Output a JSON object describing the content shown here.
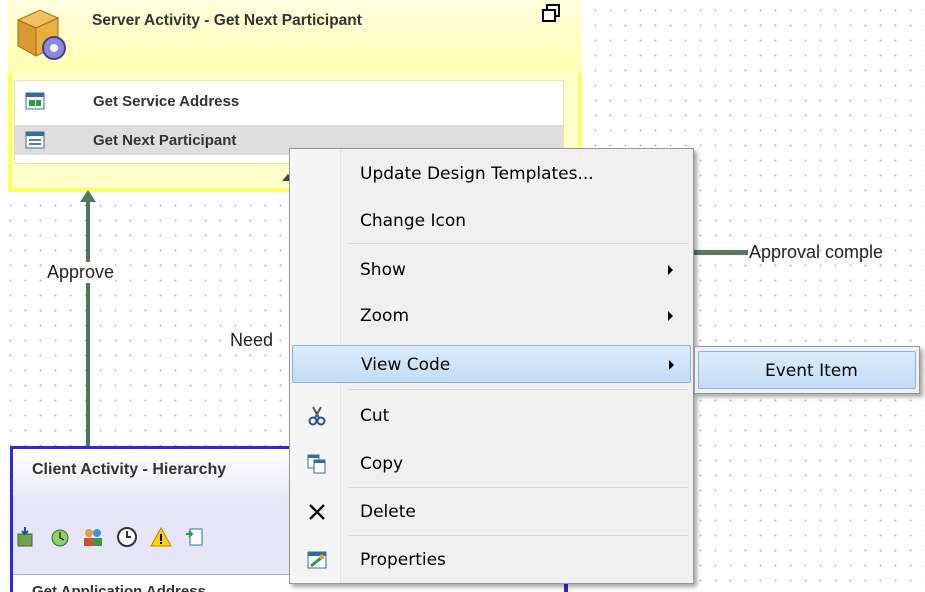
{
  "server_activity": {
    "title": "Server Activity - Get Next Participant",
    "items": [
      {
        "label": "Get Service Address",
        "icon": "service-address-icon"
      },
      {
        "label": "Get Next Participant",
        "icon": "next-participant-icon",
        "selected": true
      }
    ]
  },
  "connectors": {
    "approve": "Approve",
    "need": "Need",
    "approval_complete": "Approval comple"
  },
  "client_activity": {
    "title": "Client Activity - Hierarchy",
    "toolbar_icons": [
      "input-icon",
      "timer-icon",
      "users-icon",
      "clock-icon",
      "warning-icon",
      "output-icon"
    ],
    "first_item": "Get Application Address"
  },
  "context_menu": {
    "items": [
      {
        "label": "Update Design Templates..."
      },
      {
        "label": "Change Icon"
      },
      {
        "label": "Show",
        "submenu": true
      },
      {
        "label": "Zoom",
        "submenu": true
      },
      {
        "label": "View Code",
        "submenu": true,
        "highlighted": true
      },
      {
        "label": "Cut",
        "icon": "scissors-icon"
      },
      {
        "label": "Copy",
        "icon": "copy-icon"
      },
      {
        "label": "Delete",
        "icon": "delete-icon"
      },
      {
        "label": "Properties",
        "icon": "properties-icon"
      }
    ],
    "submenu": {
      "label": "Event Item"
    }
  },
  "colors": {
    "server_fill": "#ffffcc",
    "server_border": "#ffff66",
    "client_border": "#2b2bdc",
    "connector": "#4d7a59",
    "menu_highlight": "#c2dcf6"
  }
}
